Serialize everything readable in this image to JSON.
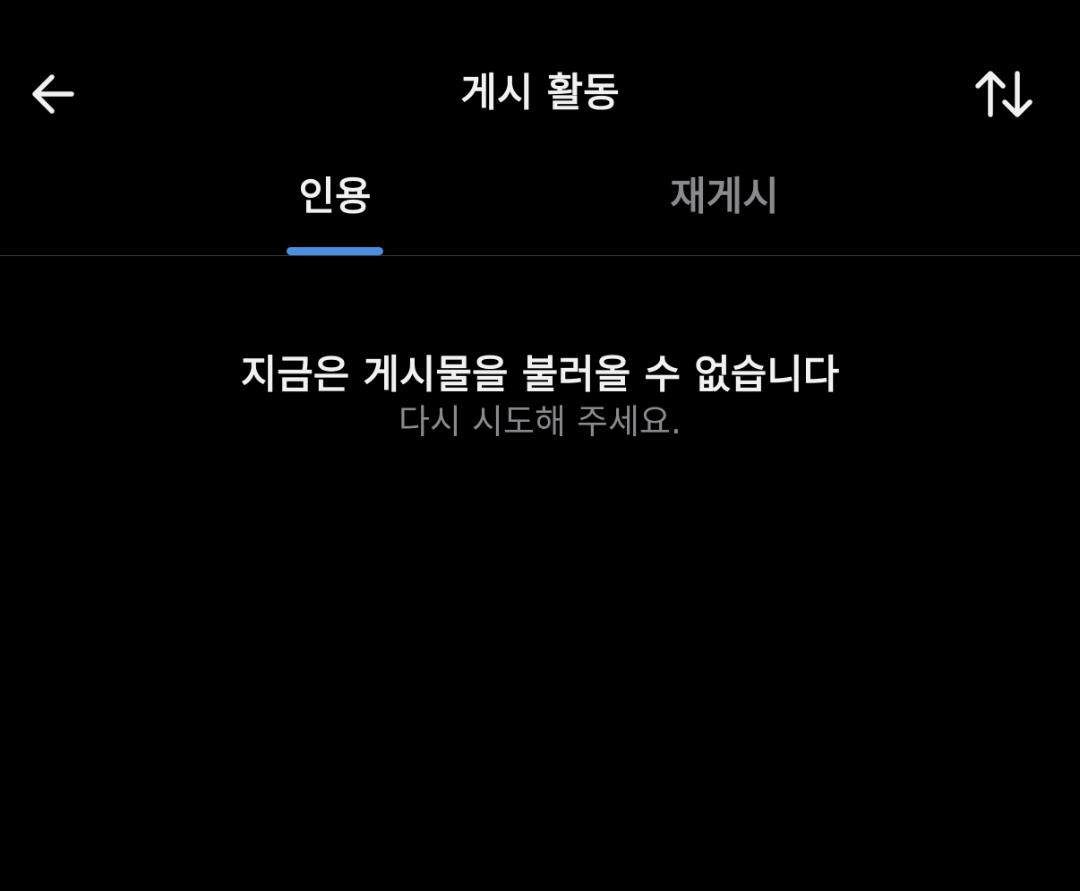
{
  "header": {
    "title": "게시 활동",
    "back_icon": "arrow-left-icon",
    "sort_icon": "sort-arrows-icon"
  },
  "tabs": [
    {
      "label": "인용",
      "active": true
    },
    {
      "label": "재게시",
      "active": false
    }
  ],
  "colors": {
    "background": "#000000",
    "accent": "#4a8fe2",
    "primary_text": "#f1f1f1",
    "secondary_text": "#8a8a8e"
  },
  "empty_state": {
    "title": "지금은 게시물을 불러올 수 없습니다",
    "subtitle": "다시 시도해 주세요."
  }
}
